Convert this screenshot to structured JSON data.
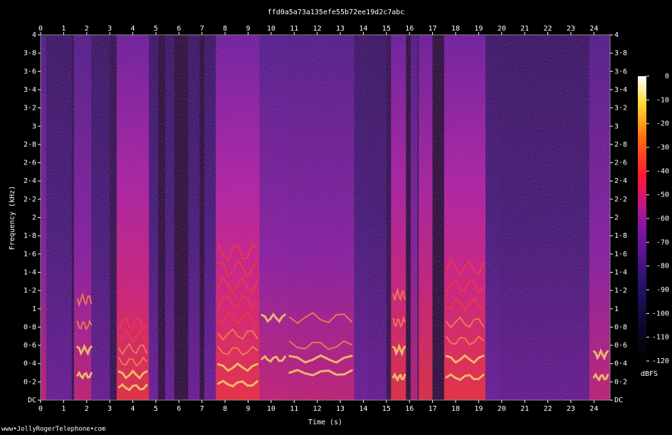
{
  "chart_data": {
    "type": "heatmap",
    "title": "ffd0a5a73a135efe55b72ee19d2c7abc",
    "xlabel": "Time (s)",
    "ylabel": "Frequency (kHz)",
    "xlim": [
      0,
      24.7
    ],
    "ylim": [
      0,
      4
    ],
    "x_ticks": [
      "0",
      "1",
      "2",
      "3",
      "4",
      "5",
      "6",
      "7",
      "8",
      "9",
      "10",
      "11",
      "12",
      "13",
      "14",
      "15",
      "16",
      "17",
      "18",
      "19",
      "20",
      "21",
      "22",
      "23",
      "24"
    ],
    "y_ticks": [
      "DC",
      "0·2",
      "0·4",
      "0·6",
      "0·8",
      "1",
      "1·2",
      "1·4",
      "1·6",
      "1·8",
      "2",
      "2·2",
      "2·4",
      "2·6",
      "2·8",
      "3",
      "3·2",
      "3·4",
      "3·6",
      "3·8",
      "4"
    ],
    "colorbar": {
      "label": "dBFS",
      "ticks": [
        "0",
        "-10",
        "-20",
        "-30",
        "-40",
        "-50",
        "-60",
        "-70",
        "-80",
        "-90",
        "-100",
        "-110",
        "-120"
      ],
      "range": [
        -120,
        0
      ]
    },
    "colors": {
      "background": "#000000",
      "silence": "#0c0628",
      "low": "#2a1370",
      "mid": "#b0189a",
      "high": "#ff2a10",
      "peak": "#ffee40",
      "max": "#ffffff"
    },
    "segments": [
      {
        "t0": 0.0,
        "t1": 0.25,
        "intensity": 0.45,
        "top": 4.0
      },
      {
        "t0": 0.25,
        "t1": 1.35,
        "intensity": 0.25,
        "top": 4.0
      },
      {
        "t0": 1.45,
        "t1": 2.2,
        "intensity": 0.55,
        "top": 4.0
      },
      {
        "t0": 2.2,
        "t1": 3.0,
        "intensity": 0.15,
        "top": 4.0
      },
      {
        "t0": 3.3,
        "t1": 4.7,
        "intensity": 0.75,
        "top": 4.0
      },
      {
        "t0": 4.7,
        "t1": 5.1,
        "intensity": 0.3,
        "top": 4.0
      },
      {
        "t0": 5.4,
        "t1": 5.8,
        "intensity": 0.25,
        "top": 4.0
      },
      {
        "t0": 6.4,
        "t1": 6.9,
        "intensity": 0.25,
        "top": 4.0
      },
      {
        "t0": 7.1,
        "t1": 7.6,
        "intensity": 0.3,
        "top": 4.0
      },
      {
        "t0": 7.6,
        "t1": 9.5,
        "intensity": 0.85,
        "top": 4.0
      },
      {
        "t0": 9.5,
        "t1": 10.8,
        "intensity": 0.6,
        "top": 4.0
      },
      {
        "t0": 10.8,
        "t1": 13.6,
        "intensity": 0.55,
        "top": 4.0
      },
      {
        "t0": 13.6,
        "t1": 14.2,
        "intensity": 0.3,
        "top": 4.0
      },
      {
        "t0": 14.2,
        "t1": 15.0,
        "intensity": 0.12,
        "top": 4.0
      },
      {
        "t0": 15.2,
        "t1": 15.85,
        "intensity": 0.7,
        "top": 4.0
      },
      {
        "t0": 16.05,
        "t1": 16.35,
        "intensity": 0.4,
        "top": 4.0
      },
      {
        "t0": 16.4,
        "t1": 17.0,
        "intensity": 0.65,
        "top": 4.0
      },
      {
        "t0": 17.5,
        "t1": 19.3,
        "intensity": 0.8,
        "top": 4.0
      },
      {
        "t0": 19.3,
        "t1": 19.9,
        "intensity": 0.3,
        "top": 4.0
      },
      {
        "t0": 19.9,
        "t1": 23.8,
        "intensity": 0.1,
        "top": 4.0
      },
      {
        "t0": 23.8,
        "t1": 24.7,
        "intensity": 0.55,
        "top": 4.0
      }
    ],
    "harmonics": [
      {
        "t0": 1.6,
        "t1": 2.2,
        "f": [
          0.27,
          0.55,
          0.82,
          1.1
        ]
      },
      {
        "t0": 3.4,
        "t1": 4.6,
        "f": [
          0.14,
          0.28,
          0.42,
          0.56,
          0.7,
          0.84
        ]
      },
      {
        "t0": 7.7,
        "t1": 9.4,
        "f": [
          0.18,
          0.36,
          0.54,
          0.72,
          0.9,
          1.08,
          1.26,
          1.44,
          1.62
        ]
      },
      {
        "t0": 9.6,
        "t1": 10.6,
        "f": [
          0.45,
          0.9
        ]
      },
      {
        "t0": 10.8,
        "t1": 13.5,
        "f": [
          0.3,
          0.45,
          0.6,
          0.9
        ]
      },
      {
        "t0": 15.3,
        "t1": 15.8,
        "f": [
          0.25,
          0.55,
          0.85,
          1.15
        ]
      },
      {
        "t0": 17.6,
        "t1": 19.2,
        "f": [
          0.25,
          0.45,
          0.65,
          0.85,
          1.05,
          1.25,
          1.45
        ]
      },
      {
        "t0": 24.0,
        "t1": 24.6,
        "f": [
          0.25,
          0.5
        ]
      }
    ],
    "silent_gaps": [
      {
        "t0": 5.1,
        "t1": 5.4
      },
      {
        "t0": 5.8,
        "t1": 6.4
      },
      {
        "t0": 6.9,
        "t1": 7.1
      },
      {
        "t0": 15.85,
        "t1": 16.05
      },
      {
        "t0": 17.0,
        "t1": 17.5
      }
    ]
  },
  "watermark": "www•JollyRogerTelephone•com"
}
